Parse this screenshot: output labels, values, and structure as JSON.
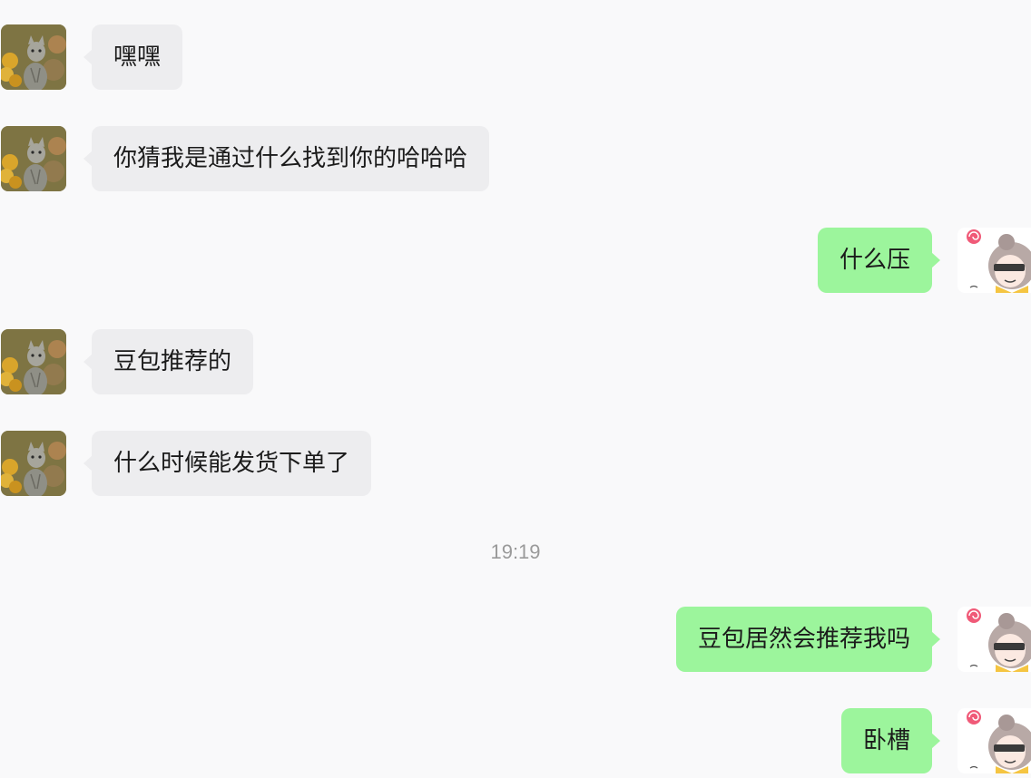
{
  "messages": [
    {
      "side": "in",
      "text": "嘿嘿",
      "avatar": "cat-avatar"
    },
    {
      "side": "in",
      "text": "你猜我是通过什么找到你的哈哈哈",
      "avatar": "cat-avatar"
    },
    {
      "side": "out",
      "text": "什么压",
      "avatar": "anime-girl-avatar"
    },
    {
      "side": "in",
      "text": "豆包推荐的",
      "avatar": "cat-avatar"
    },
    {
      "side": "in",
      "text": "什么时候能发货下单了",
      "avatar": "cat-avatar"
    },
    {
      "side": "out",
      "text": "豆包居然会推荐我吗",
      "avatar": "anime-girl-avatar"
    },
    {
      "side": "out",
      "text": "卧槽",
      "avatar": "anime-girl-avatar"
    }
  ],
  "timestamp": "19:19",
  "colors": {
    "background": "#f9f9fa",
    "incoming_bubble": "#ededef",
    "outgoing_bubble": "#9cf59c",
    "timestamp_text": "#9a9a9a"
  }
}
